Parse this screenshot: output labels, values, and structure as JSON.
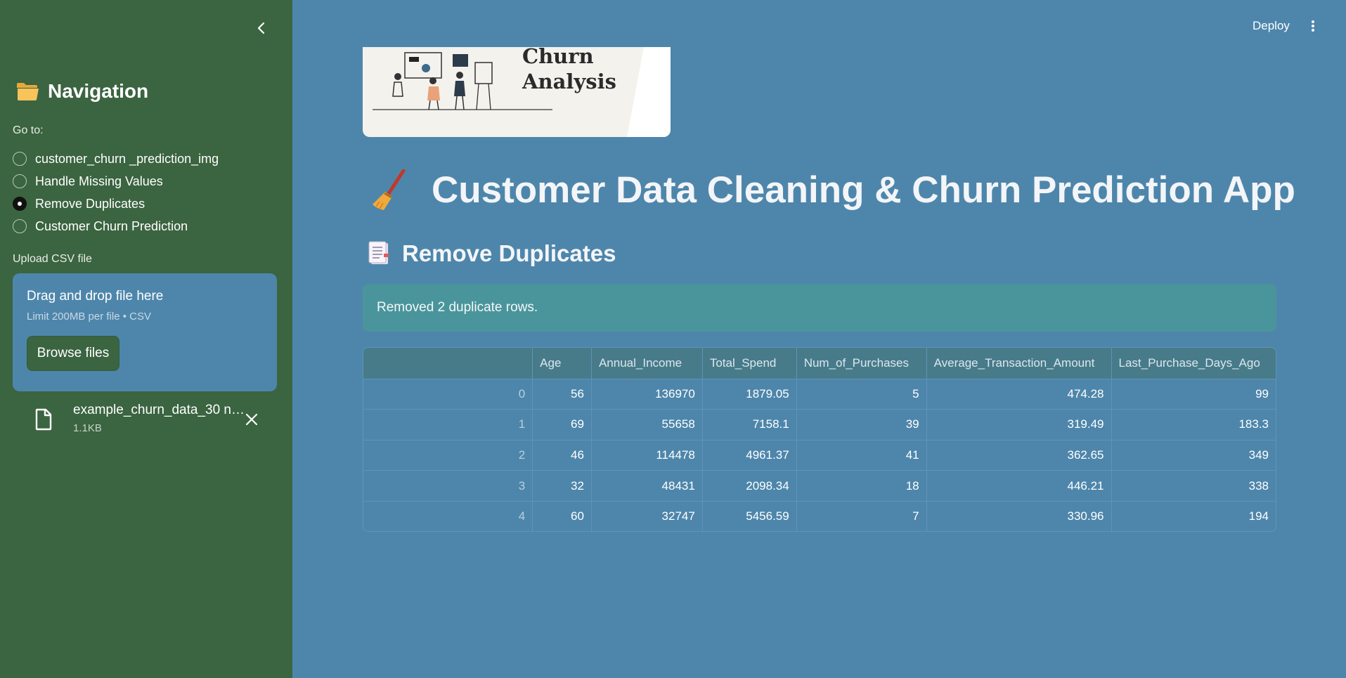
{
  "sidebar": {
    "title": "Navigation",
    "goto_label": "Go to:",
    "nav_options": [
      {
        "label": "customer_churn _prediction_img",
        "selected": false
      },
      {
        "label": "Handle Missing Values",
        "selected": false
      },
      {
        "label": "Remove Duplicates",
        "selected": true
      },
      {
        "label": "Customer Churn Prediction",
        "selected": false
      }
    ],
    "upload_label": "Upload CSV file",
    "dropzone": {
      "title": "Drag and drop file here",
      "subtitle": "Limit 200MB per file • CSV",
      "browse_label": "Browse files"
    },
    "file": {
      "name": "example_churn_data_30 n…",
      "size": "1.1KB"
    }
  },
  "header": {
    "deploy_label": "Deploy"
  },
  "main": {
    "banner_text_line1": "Churn",
    "banner_text_line2": "Analysis",
    "app_title": "Customer Data Cleaning & Churn Prediction App",
    "section_title": "Remove Duplicates",
    "alert_text": "Removed 2 duplicate rows.",
    "table": {
      "columns": [
        "",
        "Age",
        "Annual_Income",
        "Total_Spend",
        "Num_of_Purchases",
        "Average_Transaction_Amount",
        "Last_Purchase_Days_Ago"
      ],
      "rows": [
        [
          "0",
          "56",
          "136970",
          "1879.05",
          "5",
          "474.28",
          "99"
        ],
        [
          "1",
          "69",
          "55658",
          "7158.1",
          "39",
          "319.49",
          "183.3"
        ],
        [
          "2",
          "46",
          "114478",
          "4961.37",
          "41",
          "362.65",
          "349"
        ],
        [
          "3",
          "32",
          "48431",
          "2098.34",
          "18",
          "446.21",
          "338"
        ],
        [
          "4",
          "60",
          "32747",
          "5456.59",
          "7",
          "330.96",
          "194"
        ]
      ]
    }
  },
  "colors": {
    "sidebar_bg": "#3b6440",
    "main_bg": "#4e86ab",
    "alert_bg": "#4a959c",
    "table_header_bg": "#477b8a"
  }
}
